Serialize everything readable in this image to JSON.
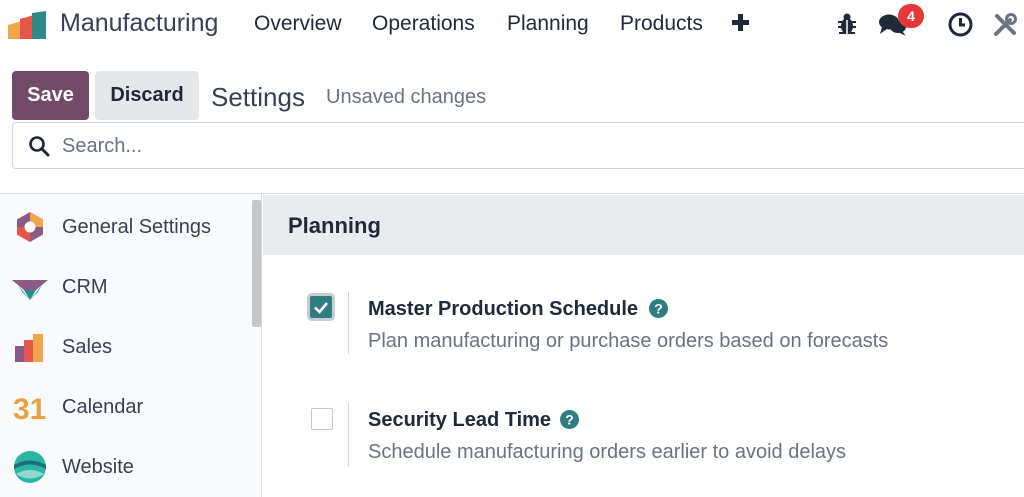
{
  "navbar": {
    "app_name": "Manufacturing",
    "menu": [
      "Overview",
      "Operations",
      "Planning",
      "Products"
    ],
    "messages_badge": "4"
  },
  "control_panel": {
    "save_label": "Save",
    "discard_label": "Discard",
    "title": "Settings",
    "status": "Unsaved changes"
  },
  "search": {
    "placeholder": "Search..."
  },
  "sidebar": {
    "items": [
      {
        "label": "General Settings",
        "icon": "general-settings-icon"
      },
      {
        "label": "CRM",
        "icon": "crm-icon"
      },
      {
        "label": "Sales",
        "icon": "sales-icon"
      },
      {
        "label": "Calendar",
        "icon": "calendar-icon",
        "icon_text": "31"
      },
      {
        "label": "Website",
        "icon": "website-icon"
      }
    ]
  },
  "main": {
    "section_title": "Planning",
    "settings": [
      {
        "title": "Master Production Schedule",
        "description": "Plan manufacturing or purchase orders based on forecasts",
        "checked": true
      },
      {
        "title": "Security Lead Time",
        "description": "Schedule manufacturing orders earlier to avoid delays",
        "checked": false
      }
    ]
  },
  "colors": {
    "brand": "#714b67",
    "accent": "#2e7d80",
    "badge": "#e4383b"
  }
}
